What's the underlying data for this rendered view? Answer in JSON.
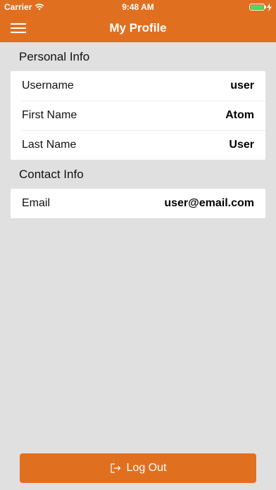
{
  "status_bar": {
    "carrier": "Carrier",
    "time": "9:48 AM"
  },
  "nav": {
    "title": "My Profile",
    "menu_icon": "hamburger-menu-icon"
  },
  "personal_info": {
    "header": "Personal Info",
    "rows": [
      {
        "label": "Username",
        "value": "user"
      },
      {
        "label": "First Name",
        "value": "Atom"
      },
      {
        "label": "Last Name",
        "value": "User"
      }
    ]
  },
  "contact_info": {
    "header": "Contact Info",
    "rows": [
      {
        "label": "Email",
        "value": "user@email.com"
      }
    ]
  },
  "logout": {
    "label": "Log Out",
    "icon": "logout-icon"
  },
  "colors": {
    "accent": "#e07020",
    "background": "#e0e0e0",
    "card": "#ffffff",
    "battery": "#4cd964"
  }
}
